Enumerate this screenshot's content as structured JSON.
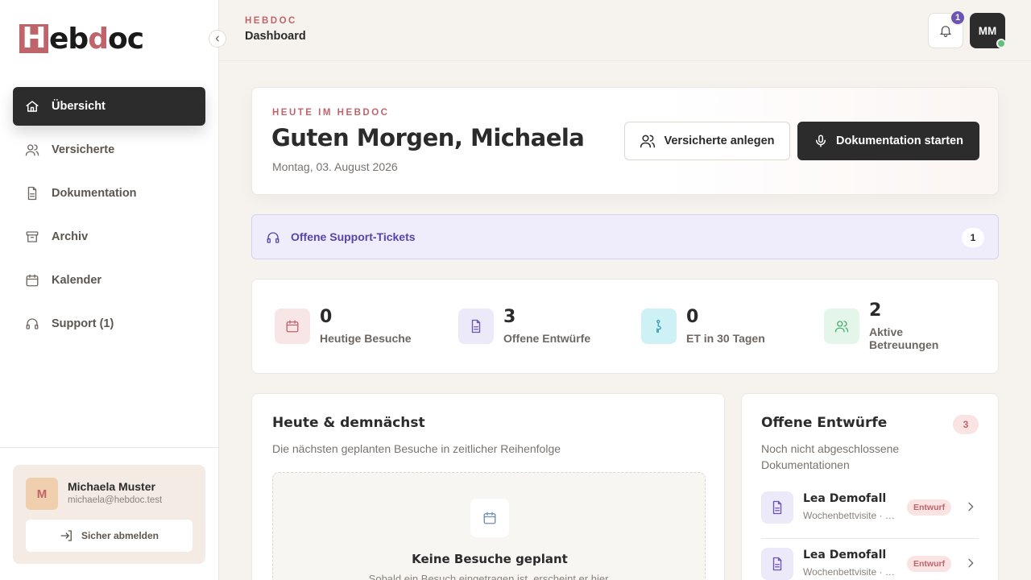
{
  "brand": {
    "logo_h": "H",
    "logo_eb": "eb",
    "logo_d": "d",
    "logo_oc": "oc",
    "accent": "#c0646b"
  },
  "sidebar": {
    "items": [
      {
        "label": "Übersicht",
        "icon": "home-icon",
        "active": true
      },
      {
        "label": "Versicherte",
        "icon": "users-icon"
      },
      {
        "label": "Dokumentation",
        "icon": "document-icon"
      },
      {
        "label": "Archiv",
        "icon": "archive-icon"
      },
      {
        "label": "Kalender",
        "icon": "calendar-icon"
      },
      {
        "label": "Support (1)",
        "icon": "headset-icon"
      }
    ],
    "user": {
      "initial": "M",
      "name": "Michaela Muster",
      "email": "michaela@hebdoc.test",
      "logout_label": "Sicher abmelden"
    }
  },
  "topbar": {
    "eyebrow": "HEBDOC",
    "title": "Dashboard",
    "notification_count": "1",
    "avatar_initials": "MM"
  },
  "hero": {
    "eyebrow": "HEUTE IM HEBDOC",
    "greeting": "Guten Morgen, Michaela",
    "date": "Montag, 03. August 2026",
    "btn_add_insured": "Versicherte anlegen",
    "btn_start_doc": "Dokumentation starten"
  },
  "support": {
    "label": "Offene Support-Tickets",
    "count": "1"
  },
  "stats": [
    {
      "value": "0",
      "label": "Heutige Besuche",
      "icon": "calendar-icon",
      "color": "#c0646b"
    },
    {
      "value": "3",
      "label": "Offene Entwürfe",
      "icon": "document-icon",
      "color": "#6b54b2"
    },
    {
      "value": "0",
      "label": "ET in 30 Tagen",
      "icon": "pregnant-icon",
      "color": "#3a9fb0"
    },
    {
      "value": "2",
      "label": "Aktive Betreuungen",
      "icon": "users-icon",
      "color": "#4caf72"
    }
  ],
  "upcoming": {
    "title": "Heute & demnächst",
    "subtitle": "Die nächsten geplanten Besuche in zeitlicher Reihenfolge",
    "empty_title": "Keine Besuche geplant",
    "empty_text": "Sobald ein Besuch eingetragen ist, erscheint er hier."
  },
  "drafts": {
    "title": "Offene Entwürfe",
    "count": "3",
    "subtitle": "Noch nicht abgeschlossene Dokumentationen",
    "items": [
      {
        "name": "Lea Demofall",
        "meta": "Wochenbettvisite · …",
        "tag": "Entwurf"
      },
      {
        "name": "Lea Demofall",
        "meta": "Wochenbettvisite · …",
        "tag": "Entwurf"
      }
    ]
  }
}
